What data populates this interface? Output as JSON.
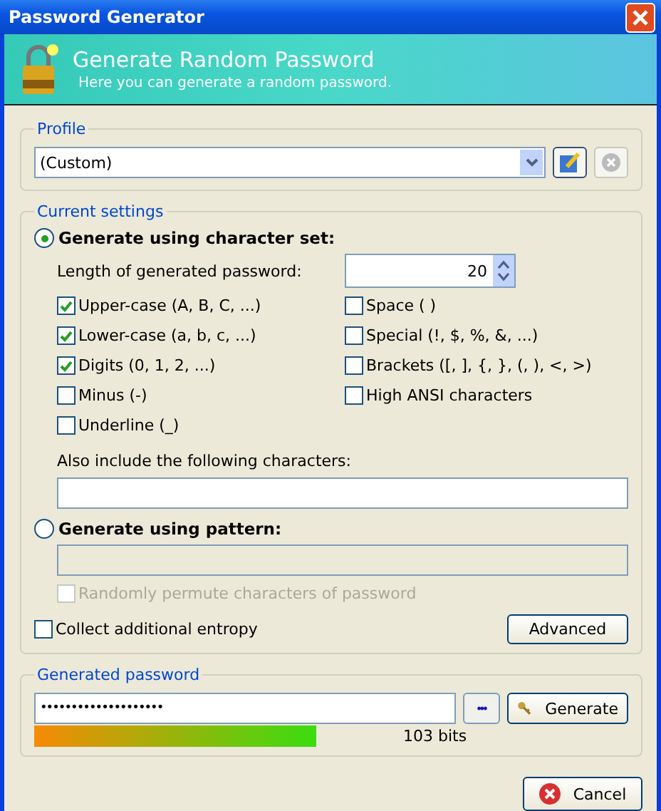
{
  "window": {
    "title": "Password Generator"
  },
  "header": {
    "title": "Generate Random Password",
    "subtitle": "Here you can generate a random password."
  },
  "profile": {
    "label": "Profile",
    "value": "(Custom)"
  },
  "settings": {
    "label": "Current settings",
    "modes": [
      {
        "label": "Generate using character set:",
        "selected": true
      },
      {
        "label": "Generate using pattern:",
        "selected": false
      }
    ],
    "length_label": "Length of generated password:",
    "length_value": "20",
    "charsets": [
      {
        "label": "Upper-case (A, B, C, ...)",
        "checked": true
      },
      {
        "label": "Space ( )",
        "checked": false
      },
      {
        "label": "Lower-case (a, b, c, ...)",
        "checked": true
      },
      {
        "label": "Special (!, $, %, &, ...)",
        "checked": false
      },
      {
        "label": "Digits (0, 1, 2, ...)",
        "checked": true
      },
      {
        "label": "Brackets ([, ], {, }, (, ), <, >)",
        "checked": false
      },
      {
        "label": "Minus (-)",
        "checked": false
      },
      {
        "label": "High ANSI characters",
        "checked": false
      },
      {
        "label": "Underline (_)",
        "checked": false
      }
    ],
    "include_label": "Also include the following characters:",
    "permute": {
      "label": "Randomly permute characters of password",
      "checked": false,
      "disabled": true
    },
    "entropy": {
      "label": "Collect additional entropy",
      "checked": false
    },
    "advanced_button": "Advanced"
  },
  "generated": {
    "label": "Generated password",
    "value": "••••••••••••••••••••",
    "toggle": "•••",
    "generate_button": "Generate",
    "quality": {
      "reading": "103 bits"
    }
  },
  "buttons": {
    "cancel": "Cancel"
  }
}
